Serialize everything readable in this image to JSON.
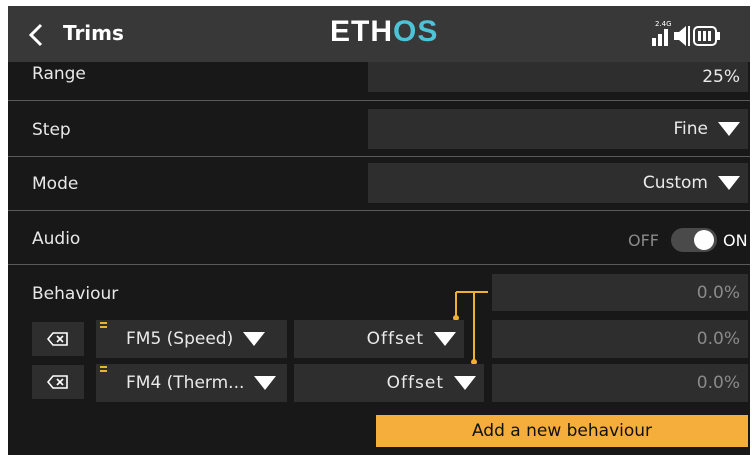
{
  "header": {
    "title": "Trims",
    "logo": {
      "part1": "ETH",
      "part2": "OS"
    },
    "status": {
      "band": "2.4G"
    }
  },
  "settings": {
    "range": {
      "label": "Range",
      "value": "25%"
    },
    "step": {
      "label": "Step",
      "value": "Fine"
    },
    "mode": {
      "label": "Mode",
      "value": "Custom"
    },
    "audio": {
      "label": "Audio",
      "off_label": "OFF",
      "on_label": "ON",
      "state": "on"
    }
  },
  "behaviour": {
    "label": "Behaviour",
    "header_value": "0.0%",
    "rows": [
      {
        "flight_mode": "FM5 (Speed)",
        "type": "Offset",
        "value": "0.0%"
      },
      {
        "flight_mode": "FM4 (Therm...",
        "type": "Offset",
        "value": "0.0%"
      }
    ],
    "add_button": "Add a new behaviour"
  },
  "colors": {
    "background": "#181818",
    "header": "#383838",
    "field": "#2e2e2e",
    "accent": "#f5ad3c",
    "logo_accent": "#4cc3d6"
  }
}
